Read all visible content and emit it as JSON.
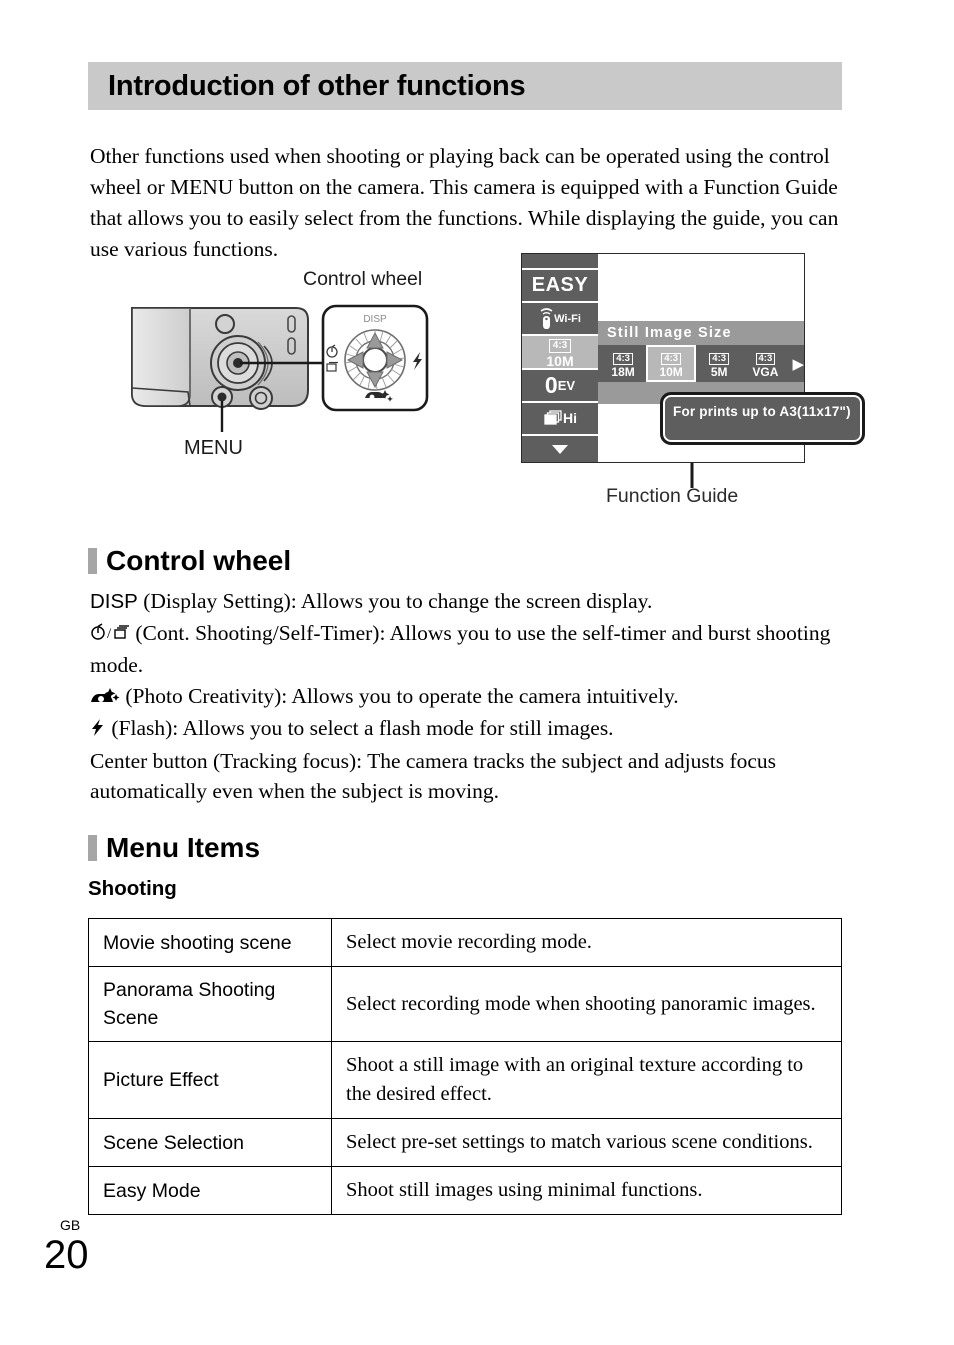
{
  "page": {
    "title": "Introduction of other functions",
    "intro": "Other functions used when shooting or playing back can be operated using the control wheel or MENU button on the camera. This camera is equipped with a Function Guide that allows you to easily select from the functions. While displaying the guide, you can use various functions.",
    "footer_locale": "GB",
    "footer_page_number": "20"
  },
  "figure": {
    "control_wheel_label": "Control wheel",
    "menu_button_label": "MENU",
    "function_guide_label": "Function Guide",
    "wheel_directions": {
      "up": "DISP",
      "left": "self-timer / cont-shooting",
      "right": "flash",
      "down": "photo-creativity",
      "center": "center-button"
    }
  },
  "lcd": {
    "sidebar": [
      {
        "id": "blank",
        "label": ""
      },
      {
        "id": "easy",
        "label": "EASY"
      },
      {
        "id": "wifi",
        "label": "Wi-Fi"
      },
      {
        "id": "image-size",
        "ratio": "4:3",
        "value": "10M"
      },
      {
        "id": "ev",
        "value": "0",
        "unit": "EV"
      },
      {
        "id": "burst",
        "label": "Hi"
      },
      {
        "id": "more",
        "label": "scroll-down"
      }
    ],
    "menu_title": "Still Image Size",
    "options": [
      {
        "ratio": "4:3",
        "value": "18M",
        "selected": false
      },
      {
        "ratio": "4:3",
        "value": "10M",
        "selected": true
      },
      {
        "ratio": "4:3",
        "value": "5M",
        "selected": false
      },
      {
        "ratio": "4:3",
        "value": "VGA",
        "selected": false
      }
    ],
    "next_arrow": "▶",
    "selected_value_label": "10M",
    "function_guide_text": "For prints up to A3(11x17\")"
  },
  "sections": {
    "control_wheel": {
      "heading": "Control wheel",
      "lines": [
        {
          "prefix": "DISP",
          "prefix_style": "sans",
          "text": " (Display Setting): Allows you to change the screen display."
        },
        {
          "prefix": "⏱/❐",
          "prefix_style": "glyph",
          "text": " (Cont. Shooting/Self-Timer): Allows you to use the self-timer and burst shooting mode."
        },
        {
          "prefix": "camera-sparkle",
          "prefix_style": "glyph",
          "text": " (Photo Creativity): Allows you to operate the camera intuitively."
        },
        {
          "prefix": "⚡",
          "prefix_style": "glyph",
          "text": " (Flash): Allows you to select a flash mode for still images."
        },
        {
          "prefix": "",
          "prefix_style": "none",
          "text": "Center button (Tracking focus): The camera tracks the subject and adjusts focus automatically even when the subject is moving."
        }
      ]
    },
    "menu_items": {
      "heading": "Menu Items",
      "subheading": "Shooting",
      "table": {
        "rows": [
          {
            "name": "Movie shooting scene",
            "description": "Select movie recording mode."
          },
          {
            "name": "Panorama Shooting Scene",
            "description": "Select recording mode when shooting panoramic images."
          },
          {
            "name": "Picture Effect",
            "description": "Shoot a still image with an original texture according to the desired effect."
          },
          {
            "name": "Scene Selection",
            "description": "Select pre-set settings to match various scene conditions."
          },
          {
            "name": "Easy Mode",
            "description": "Shoot still images using minimal functions."
          }
        ]
      }
    }
  },
  "colors": {
    "header_band": "#c9c9c9",
    "section_bar": "#a6a6a6",
    "lcd_dark": "#5e5e5e",
    "lcd_mid": "#9a9a9a",
    "lcd_light": "#b8b8b8"
  }
}
